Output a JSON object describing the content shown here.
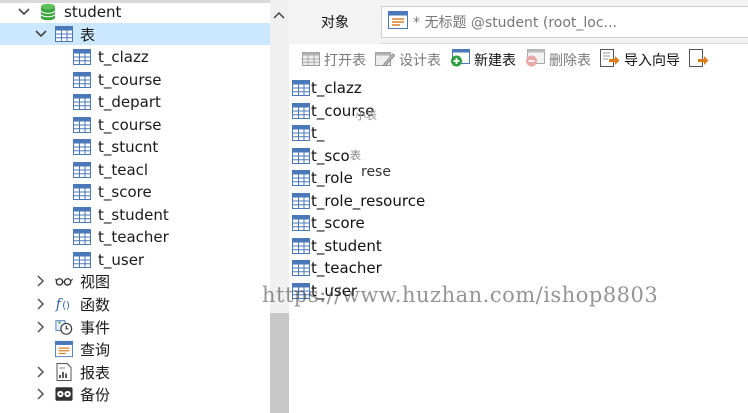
{
  "sidebar": {
    "database": {
      "label": "student",
      "expanded": true
    },
    "tables_group": {
      "label": "表",
      "expanded": true,
      "selected": true
    },
    "tables": [
      {
        "label": "t_clazz"
      },
      {
        "label": "t_course"
      },
      {
        "label": "t_depart"
      },
      {
        "label": "t_course"
      },
      {
        "label": "t_stucnt"
      },
      {
        "label": "t_teacl"
      },
      {
        "label": "t_score"
      },
      {
        "label": "t_student"
      },
      {
        "label": "t_teacher"
      },
      {
        "label": "t_user"
      }
    ],
    "groups": [
      {
        "label": "视图",
        "icon": "view-icon"
      },
      {
        "label": "函数",
        "icon": "function-icon"
      },
      {
        "label": "事件",
        "icon": "event-icon"
      },
      {
        "label": "查询",
        "icon": "query-icon"
      },
      {
        "label": "报表",
        "icon": "report-icon"
      },
      {
        "label": "备份",
        "icon": "backup-icon"
      }
    ]
  },
  "tabs": {
    "objects_label": "对象",
    "query_tab_label": "* 无标题 @student (root_loc..."
  },
  "toolbar": {
    "open_table": "打开表",
    "design_table": "设计表",
    "new_table": "新建表",
    "delete_table": "删除表",
    "import_wizard": "导入向导"
  },
  "objects": [
    {
      "label": "t_clazz"
    },
    {
      "label": "t_course"
    },
    {
      "label": "t_"
    },
    {
      "label": "t_sco"
    },
    {
      "label": "t_role"
    },
    {
      "label": "t_role_resource"
    },
    {
      "label": "t_score"
    },
    {
      "label": "t_student"
    },
    {
      "label": "t_teacher"
    },
    {
      "label": "t_user"
    }
  ],
  "overlays": {
    "cn_small_1": "小表",
    "cn_small_2": "表",
    "rese": "rese"
  },
  "watermark": "https://www.huzhan.com/ishop8803",
  "colors": {
    "selection": "#cce8ff",
    "db_icon_green": "#3aa23a",
    "table_icon_blue": "#4a78b8",
    "new_table_green": "#2e9e3e",
    "import_orange": "#e07b18"
  }
}
